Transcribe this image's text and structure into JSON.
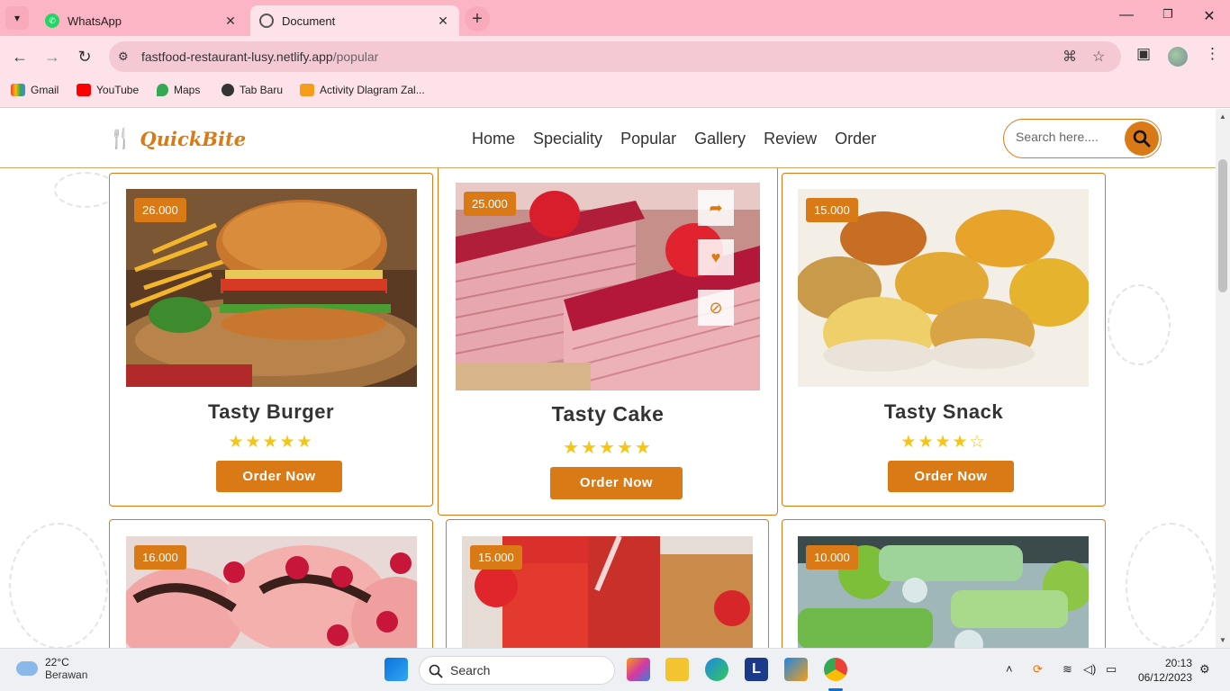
{
  "browser": {
    "tabs": [
      {
        "title": "WhatsApp",
        "active": false
      },
      {
        "title": "Document",
        "active": true
      }
    ],
    "url_host": "fastfood-restaurant-lusy.netlify.app",
    "url_path": "/popular",
    "bookmarks": [
      "Gmail",
      "YouTube",
      "Maps",
      "Tab Baru",
      "Activity Dlagram Zal..."
    ]
  },
  "site": {
    "brand": "QuickBite",
    "nav": [
      "Home",
      "Speciality",
      "Popular",
      "Gallery",
      "Review",
      "Order"
    ],
    "search_placeholder": "Search here....",
    "accent_color": "#d97a16",
    "star_color": "#f5c518"
  },
  "cards": [
    {
      "price": "26.000",
      "name": "Tasty Burger",
      "stars": "★★★★★",
      "rating": 5,
      "button": "Order Now"
    },
    {
      "price": "25.000",
      "name": "Tasty Cake",
      "stars": "★★★★★",
      "rating": 5,
      "button": "Order Now"
    },
    {
      "price": "15.000",
      "name": "Tasty Snack",
      "stars": "★★★★☆",
      "rating": 4,
      "button": "Order Now"
    },
    {
      "price": "16.000"
    },
    {
      "price": "15.000"
    },
    {
      "price": "10.000"
    }
  ],
  "taskbar": {
    "weather_temp": "22°C",
    "weather_desc": "Berawan",
    "search_label": "Search",
    "time": "20:13",
    "date": "06/12/2023"
  }
}
